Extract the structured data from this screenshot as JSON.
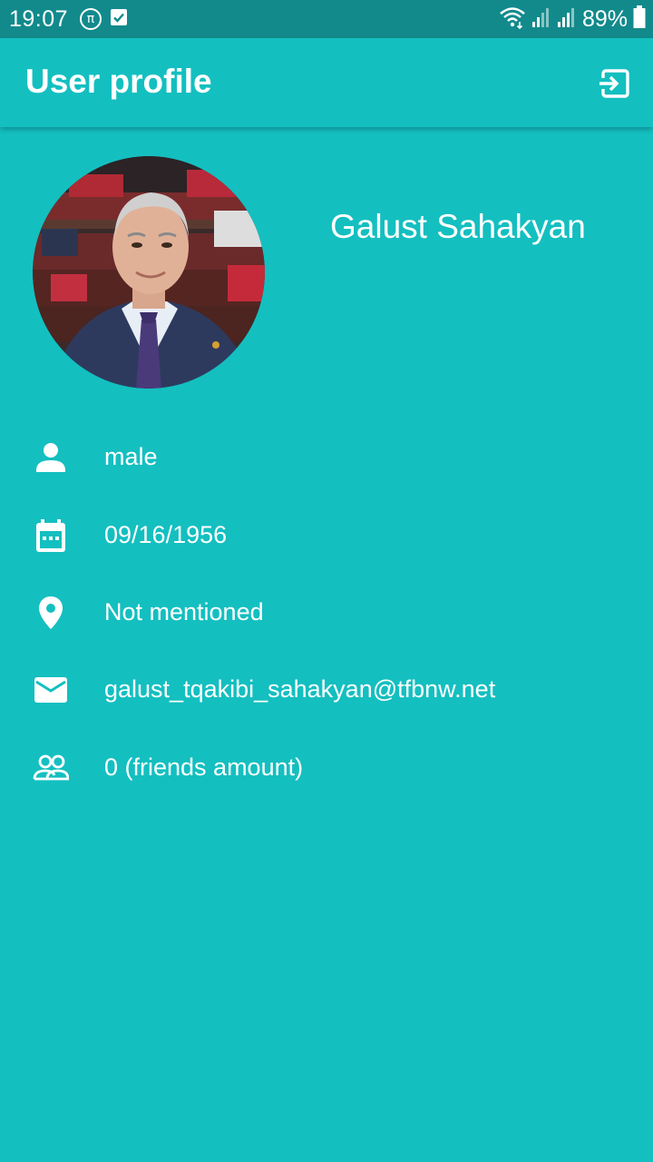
{
  "status_bar": {
    "time": "19:07",
    "battery_percent": "89%"
  },
  "header": {
    "title": "User profile",
    "logout_icon": "exit-to-app-icon"
  },
  "profile": {
    "name": "Galust Sahakyan",
    "avatar": "profile-photo"
  },
  "details": [
    {
      "icon": "person-icon",
      "text": "male"
    },
    {
      "icon": "calendar-icon",
      "text": "09/16/1956"
    },
    {
      "icon": "location-pin-icon",
      "text": "Not mentioned"
    },
    {
      "icon": "mail-icon",
      "text": "galust_tqakibi_sahakyan@tfbnw.net"
    },
    {
      "icon": "group-icon",
      "text": "0 (friends amount)"
    }
  ],
  "colors": {
    "background": "#14bfc0",
    "status_bar": "#128a8c",
    "text": "#ffffff"
  }
}
